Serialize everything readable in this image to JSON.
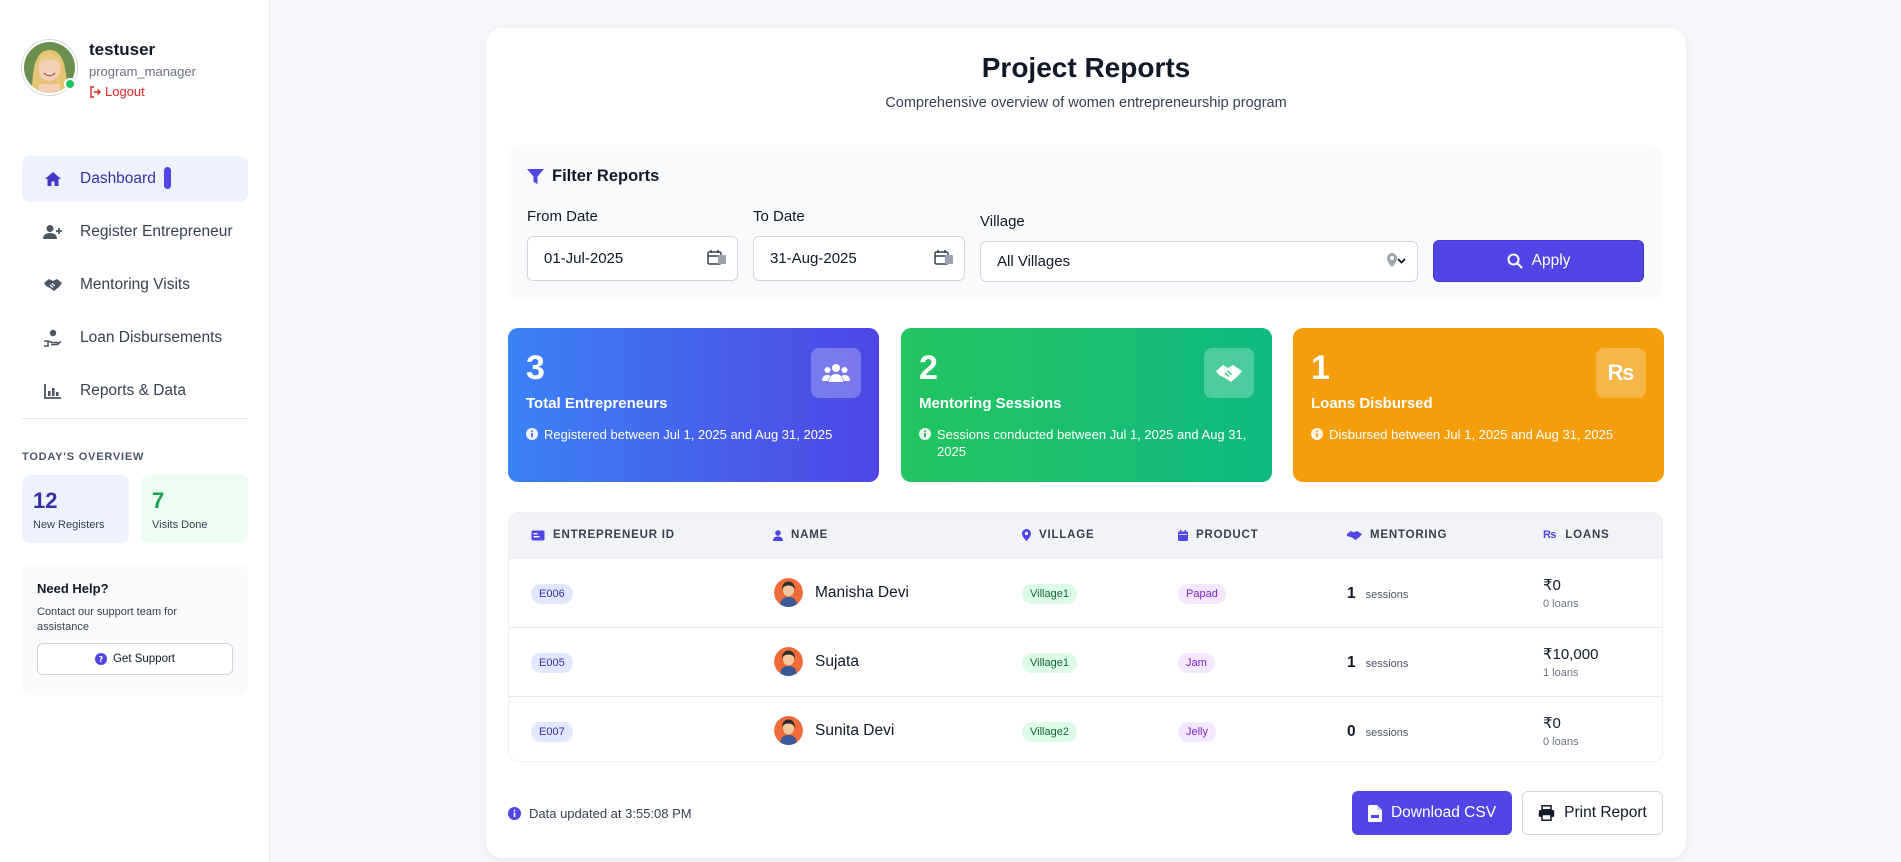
{
  "user": {
    "name": "testuser",
    "role": "program_manager",
    "logout_label": "Logout"
  },
  "nav": {
    "items": [
      {
        "label": "Dashboard",
        "icon": "home-icon",
        "active": true
      },
      {
        "label": "Register Entrepreneur",
        "icon": "user-plus-icon"
      },
      {
        "label": "Mentoring Visits",
        "icon": "handshake-icon"
      },
      {
        "label": "Loan Disbursements",
        "icon": "hand-coin-icon"
      },
      {
        "label": "Reports & Data",
        "icon": "chart-icon"
      }
    ]
  },
  "overview": {
    "label": "TODAY'S OVERVIEW",
    "new_registers": {
      "value": "12",
      "label": "New Registers"
    },
    "visits_done": {
      "value": "7",
      "label": "Visits Done"
    }
  },
  "help": {
    "title": "Need Help?",
    "text": "Contact our support team for assistance",
    "button_label": "Get Support"
  },
  "page": {
    "title": "Project Reports",
    "subtitle": "Comprehensive overview of women entrepreneurship program"
  },
  "filters": {
    "title": "Filter Reports",
    "from_label": "From Date",
    "from_value": "01-Jul-2025",
    "to_label": "To Date",
    "to_value": "31-Aug-2025",
    "village_label": "Village",
    "village_value": "All Villages",
    "apply_label": "Apply"
  },
  "kpis": {
    "entrepreneurs": {
      "value": "3",
      "title": "Total Entrepreneurs",
      "desc": "Registered between Jul 1, 2025 and Aug 31, 2025",
      "icon": "users-icon"
    },
    "mentoring": {
      "value": "2",
      "title": "Mentoring Sessions",
      "desc": "Sessions conducted between Jul 1, 2025 and Aug 31, 2025",
      "icon": "handshake-icon"
    },
    "loans": {
      "value": "1",
      "title": "Loans Disbursed",
      "desc": "Disbursed between Jul 1, 2025 and Aug 31, 2025",
      "icon": "rupee-icon",
      "icon_text": "₨"
    }
  },
  "table": {
    "headers": {
      "id": "Entrepreneur ID",
      "name": "Name",
      "village": "Village",
      "product": "Product",
      "mentoring": "Mentoring",
      "loans": "Loans"
    },
    "rows": [
      {
        "id": "E006",
        "name": "Manisha Devi",
        "village": "Village1",
        "product": "Papad",
        "sessions": "1",
        "sessions_unit": "sessions",
        "loan_amount": "₹0",
        "loan_count": "0 loans"
      },
      {
        "id": "E005",
        "name": "Sujata",
        "village": "Village1",
        "product": "Jam",
        "sessions": "1",
        "sessions_unit": "sessions",
        "loan_amount": "₹10,000",
        "loan_count": "1 loans"
      },
      {
        "id": "E007",
        "name": "Sunita Devi",
        "village": "Village2",
        "product": "Jelly",
        "sessions": "0",
        "sessions_unit": "sessions",
        "loan_amount": "₹0",
        "loan_count": "0 loans"
      }
    ]
  },
  "footer": {
    "updated": "Data updated at 3:55:08 PM",
    "download_label": "Download CSV",
    "print_label": "Print Report"
  },
  "colors": {
    "accent": "#4f46e5",
    "kpi_blue": "#3b82f6",
    "kpi_green": "#22c55e",
    "kpi_orange": "#f59e0b",
    "logout": "#dc2626"
  }
}
